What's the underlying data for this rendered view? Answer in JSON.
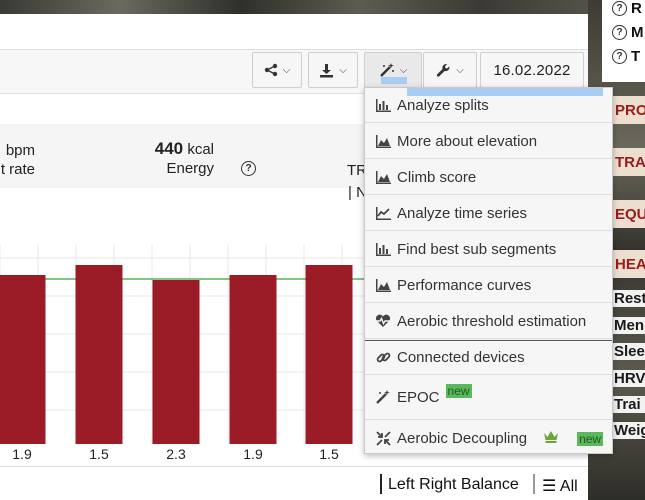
{
  "toolbar": {
    "date": "16.02.2022"
  },
  "stats": {
    "bpm_unit": "bpm",
    "heart_rate_label_fragment": "t rate",
    "energy_value": "440",
    "energy_unit": "kcal",
    "energy_label": "Energy",
    "tr_fragment": "TR",
    "n_fragment": "N"
  },
  "chart_data": {
    "type": "bar",
    "categories": [
      "1.9",
      "1.5",
      "2.3",
      "1.9",
      "1.5"
    ],
    "values": [
      1.9,
      1.5,
      2.3,
      1.9,
      1.5
    ],
    "color": "#9b1b27",
    "reference_line_color": "#3aa03a"
  },
  "bottom": {
    "balance_label": "Left Right Balance",
    "all_label": "All"
  },
  "menu": {
    "items": [
      {
        "label": "Analyze splits",
        "icon": "bar-chart-icon"
      },
      {
        "label": "More about elevation",
        "icon": "area-chart-icon"
      },
      {
        "label": "Climb score",
        "icon": "area-chart-icon"
      },
      {
        "label": "Analyze time series",
        "icon": "line-chart-icon"
      },
      {
        "label": "Find best sub segments",
        "icon": "bar-chart-icon"
      },
      {
        "label": "Performance curves",
        "icon": "area-chart-icon"
      },
      {
        "label": "Aerobic threshold estimation",
        "icon": "heartbeat-icon"
      },
      {
        "label": "Connected devices",
        "icon": "link-icon"
      },
      {
        "label": "EPOC",
        "icon": "magic-wand-icon",
        "badge": "new"
      },
      {
        "label": "Aerobic Decoupling",
        "icon": "compress-icon",
        "badge": "new",
        "crown": true
      }
    ]
  },
  "side": {
    "q_items": [
      "R",
      "M",
      "T"
    ],
    "red_items": [
      "PROG",
      "TRAI",
      "EQUI",
      "HEAL"
    ],
    "dark_items": [
      "Rest",
      "Men",
      "Slee",
      "HRV",
      "Trai",
      "Weig"
    ]
  }
}
